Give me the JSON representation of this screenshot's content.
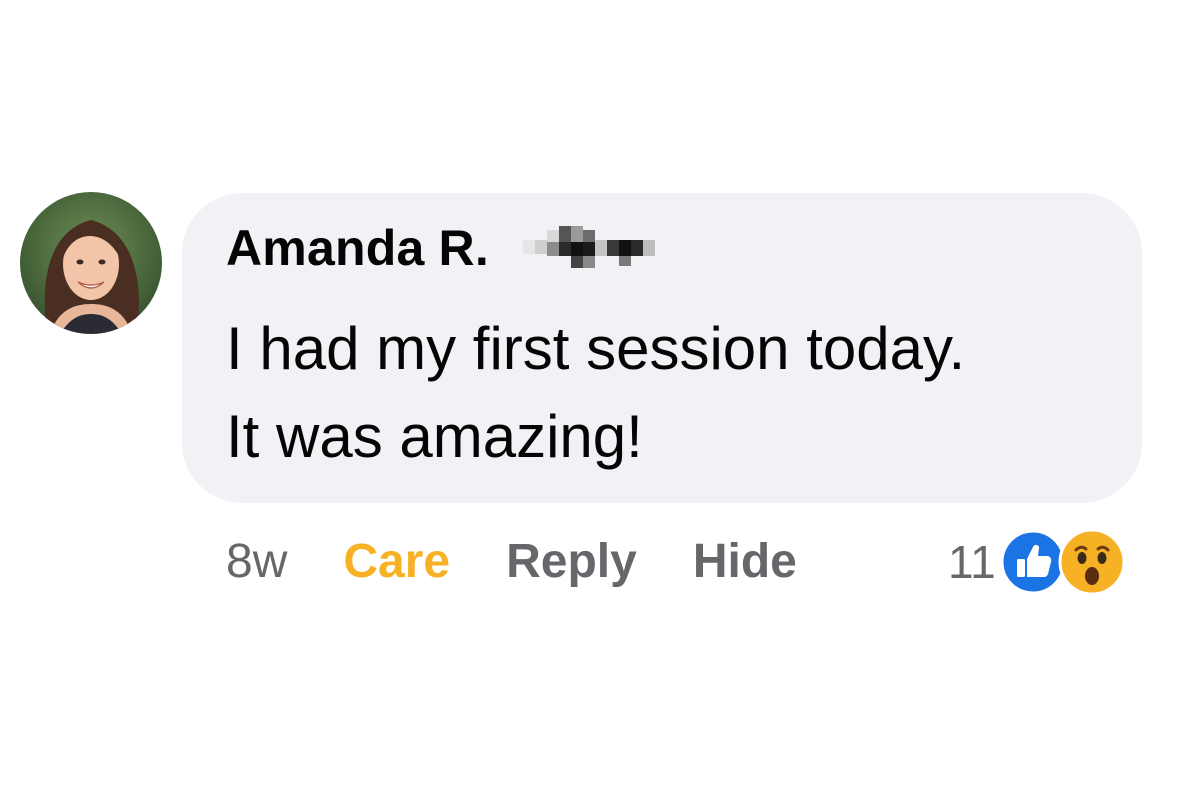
{
  "comment": {
    "author": "Amanda R.",
    "text_lines": [
      "I had my first session today.",
      "It was amazing!"
    ],
    "avatar_icon": "profile-photo"
  },
  "actions": {
    "time": "8w",
    "care_label": "Care",
    "reply_label": "Reply",
    "hide_label": "Hide"
  },
  "reactions": {
    "count": "11",
    "icons": [
      "like-icon",
      "wow-icon"
    ]
  },
  "colors": {
    "bubble": "#f0f2f5",
    "care": "#f7b125",
    "action_gray": "#65676b",
    "like_blue": "#1b74e4",
    "wow_yellow": "#f7b125"
  }
}
